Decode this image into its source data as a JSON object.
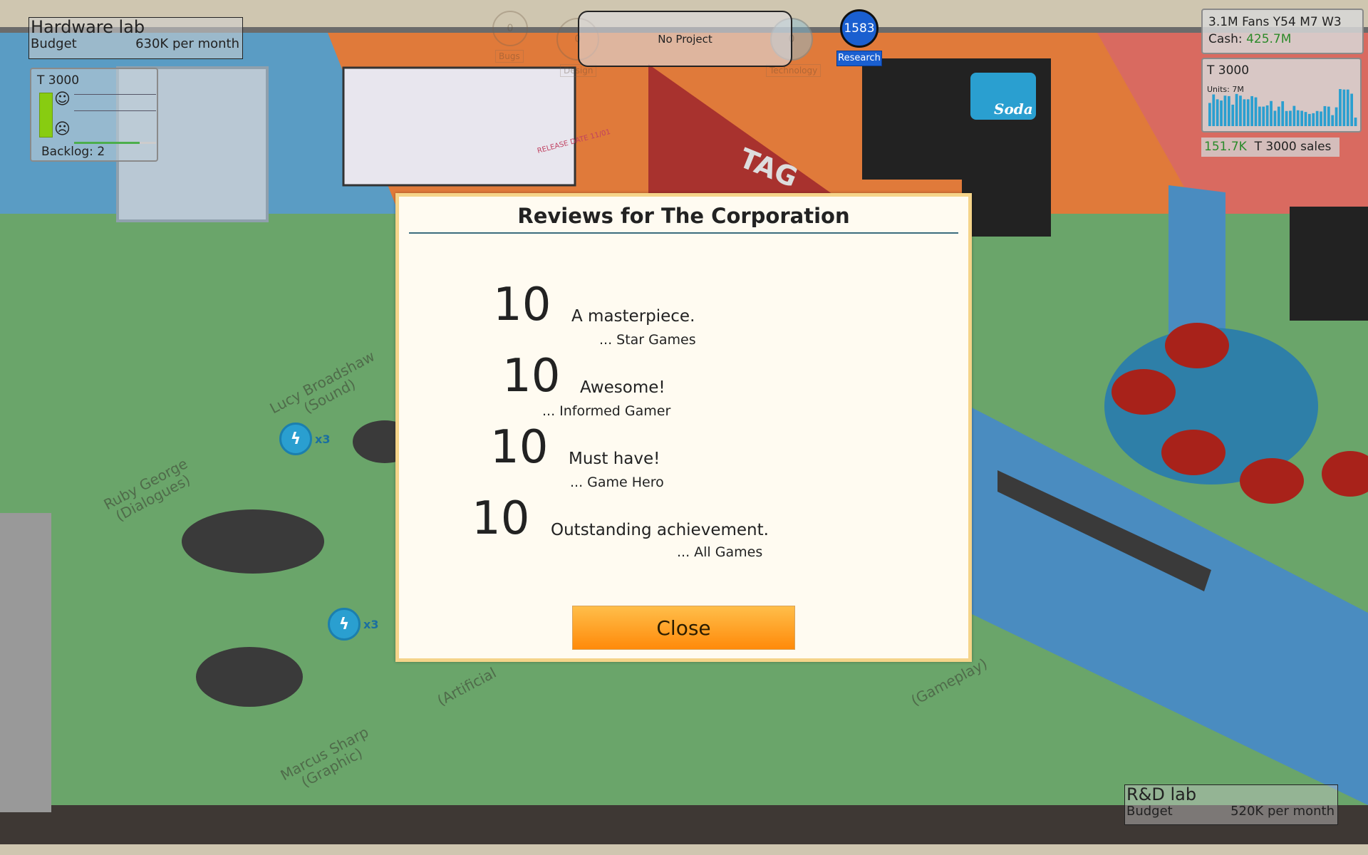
{
  "hardware_lab": {
    "title": "Hardware lab",
    "budget_label": "Budget",
    "budget_value": "630K per month"
  },
  "rd_lab": {
    "title": "R&D lab",
    "budget_label": "Budget",
    "budget_value": "520K per month"
  },
  "project_panel": {
    "name": "T 3000",
    "backlog": "Backlog: 2",
    "progress_fraction": 0.8
  },
  "project_status": {
    "label": "No Project",
    "bugs": {
      "value": "0",
      "label": "Bugs"
    },
    "design": {
      "value": "0",
      "label": "Design"
    },
    "technology": {
      "value": "0",
      "label": "Technology"
    }
  },
  "research": {
    "points": "1583",
    "label": "Research",
    "color": "#1a5fd0"
  },
  "stats": {
    "fans_date": "3.1M Fans Y54 M7 W3",
    "cash_label": "Cash:",
    "cash_value": "425.7M",
    "cash_color": "#2a8a2a"
  },
  "sales_chart": {
    "title": "T 3000",
    "units": "Units: 7M",
    "bar_color": "#2a9fd0",
    "values": [
      95,
      130,
      110,
      105,
      125,
      123,
      88,
      132,
      125,
      110,
      110,
      123,
      118,
      80,
      80,
      85,
      103,
      63,
      80,
      102,
      62,
      63,
      83,
      65,
      63,
      58,
      50,
      53,
      62,
      60,
      82,
      80,
      45,
      77,
      152,
      150,
      150,
      133,
      35
    ],
    "sales_value": "151.7K",
    "sales_label": "T 3000 sales"
  },
  "office": {
    "sign": "TAG",
    "vending": "Soda",
    "whiteboard_note": "RELEASE DATE 11/01",
    "staff": [
      {
        "name": "Lucy Broadshaw",
        "role": "(Sound)"
      },
      {
        "name": "Ruby George",
        "role": "(Dialogues)"
      },
      {
        "name": "Marcus Sharp",
        "role": "(Graphic)"
      },
      {
        "name": "",
        "role": "(Artificial"
      },
      {
        "name": "",
        "role": "(Gameplay)"
      }
    ],
    "boost": "x3"
  },
  "dialog": {
    "title": "Reviews for The Corporation",
    "reviews": [
      {
        "score": "10",
        "text": "A masterpiece.",
        "source": "... Star Games"
      },
      {
        "score": "10",
        "text": "Awesome!",
        "source": "... Informed Gamer"
      },
      {
        "score": "10",
        "text": "Must have!",
        "source": "... Game Hero"
      },
      {
        "score": "10",
        "text": "Outstanding achievement.",
        "source": "... All Games"
      }
    ],
    "close_label": "Close"
  }
}
